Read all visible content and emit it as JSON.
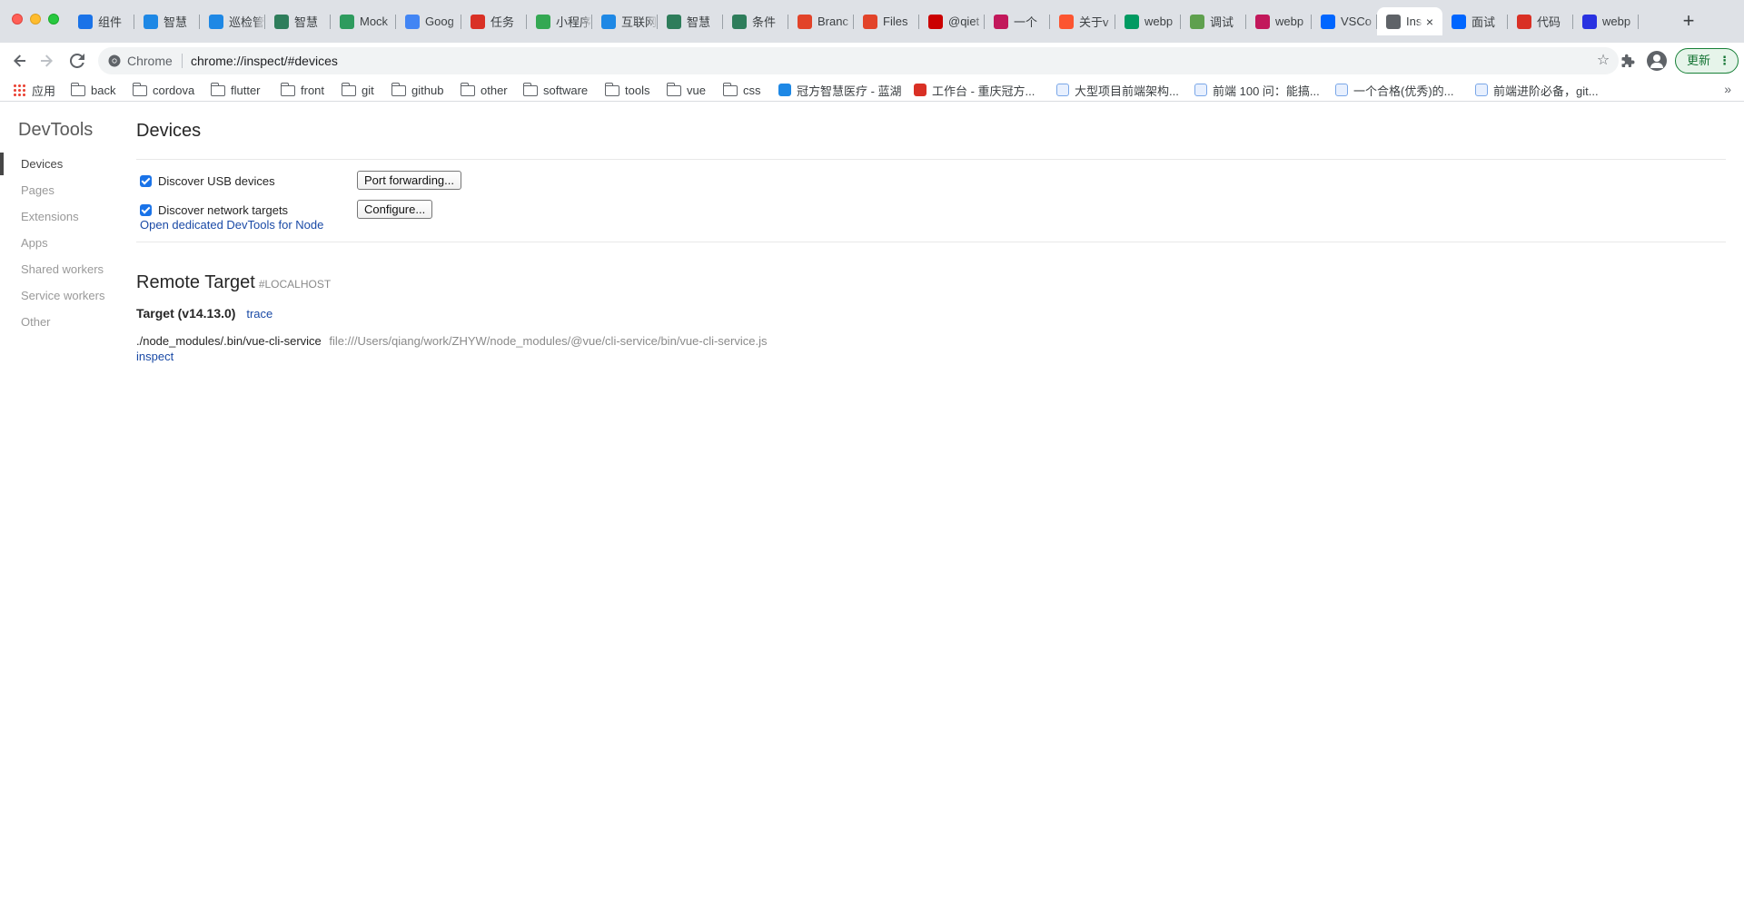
{
  "window": {
    "title": "Inspect with Chrome Developer Tools"
  },
  "tabs": [
    {
      "label": "组件",
      "icon": "blue-circle-icon",
      "color": "#1a73e8",
      "active": false
    },
    {
      "label": "智慧",
      "icon": "bluelake-icon",
      "color": "#1e88e5",
      "active": false
    },
    {
      "label": "巡检管",
      "icon": "bluelake-icon",
      "color": "#1e88e5",
      "active": false
    },
    {
      "label": "智慧",
      "icon": "vue-icon",
      "color": "#2e7d5b",
      "active": false
    },
    {
      "label": "Mock",
      "icon": "mock-icon",
      "color": "#2e9b5e",
      "active": false
    },
    {
      "label": "Goog",
      "icon": "google-translate-icon",
      "color": "#4285f4",
      "active": false
    },
    {
      "label": "任务",
      "icon": "iteye-icon",
      "color": "#d93025",
      "active": false
    },
    {
      "label": "小程序",
      "icon": "leaf-icon",
      "color": "#34a853",
      "active": false
    },
    {
      "label": "互联网",
      "icon": "bluelake-icon",
      "color": "#1e88e5",
      "active": false
    },
    {
      "label": "智慧",
      "icon": "vue-icon",
      "color": "#2e7d5b",
      "active": false
    },
    {
      "label": "条件",
      "icon": "vue-icon",
      "color": "#2e7d5b",
      "active": false
    },
    {
      "label": "Branc",
      "icon": "gitlab-icon",
      "color": "#e24329",
      "active": false
    },
    {
      "label": "Files",
      "icon": "gitlab-icon",
      "color": "#e24329",
      "active": false
    },
    {
      "label": "@qiet",
      "icon": "npm-icon",
      "color": "#cb0000",
      "active": false
    },
    {
      "label": "一个",
      "icon": "juejin-icon",
      "color": "#c2185b",
      "active": false
    },
    {
      "label": "关于v",
      "icon": "csdn-icon",
      "color": "#fc5531",
      "active": false
    },
    {
      "label": "webp",
      "icon": "segmentfault-icon",
      "color": "#009a61",
      "active": false
    },
    {
      "label": "调试",
      "icon": "node-icon",
      "color": "#5fa04e",
      "active": false
    },
    {
      "label": "webp",
      "icon": "juejin-icon",
      "color": "#c2185b",
      "active": false
    },
    {
      "label": "VSCo",
      "icon": "zhihu-icon",
      "color": "#0066ff",
      "active": false
    },
    {
      "label": "Ins",
      "icon": "globe-icon",
      "color": "#5f6368",
      "active": true
    },
    {
      "label": "面试",
      "icon": "zhihu-icon",
      "color": "#0066ff",
      "active": false
    },
    {
      "label": "代码",
      "icon": "iteye-icon",
      "color": "#d93025",
      "active": false
    },
    {
      "label": "webp",
      "icon": "baidu-icon",
      "color": "#2932e1",
      "active": false
    }
  ],
  "toolbar": {
    "back_icon": "arrow-left-icon",
    "forward_icon": "arrow-right-icon",
    "reload_icon": "reload-icon",
    "omnibox_chip": "Chrome",
    "url": "chrome://inspect/#devices",
    "update_label": "更新"
  },
  "bookmarks": [
    {
      "label": "应用",
      "icon": "apps-icon"
    },
    {
      "label": "back",
      "icon": "folder-icon"
    },
    {
      "label": "cordova",
      "icon": "folder-icon"
    },
    {
      "label": "flutter",
      "icon": "folder-icon"
    },
    {
      "label": "front",
      "icon": "folder-icon"
    },
    {
      "label": "git",
      "icon": "folder-icon"
    },
    {
      "label": "github",
      "icon": "folder-icon"
    },
    {
      "label": "other",
      "icon": "folder-icon"
    },
    {
      "label": "software",
      "icon": "folder-icon"
    },
    {
      "label": "tools",
      "icon": "folder-icon"
    },
    {
      "label": "vue",
      "icon": "folder-icon"
    },
    {
      "label": "css",
      "icon": "folder-icon"
    },
    {
      "label": "冠方智慧医疗 - 蓝湖",
      "icon": "bluelake-icon"
    },
    {
      "label": "工作台 - 重庆冠方...",
      "icon": "iteye-icon"
    },
    {
      "label": "大型项目前端架构...",
      "icon": "yuque-icon"
    },
    {
      "label": "前端 100 问：能搞...",
      "icon": "yuque-icon"
    },
    {
      "label": "一个合格(优秀)的...",
      "icon": "yuque-icon"
    },
    {
      "label": "前端进阶必备，git...",
      "icon": "yuque-icon"
    }
  ],
  "devtools": {
    "title": "DevTools",
    "nav": [
      "Devices",
      "Pages",
      "Extensions",
      "Apps",
      "Shared workers",
      "Service workers",
      "Other"
    ],
    "selected_nav": "Devices"
  },
  "devices": {
    "heading": "Devices",
    "discover_usb": {
      "label": "Discover USB devices",
      "checked": true,
      "button": "Port forwarding..."
    },
    "discover_network": {
      "label": "Discover network targets",
      "checked": true,
      "button": "Configure..."
    },
    "node_link": "Open dedicated DevTools for Node"
  },
  "remote": {
    "heading": "Remote Target",
    "sub": "#LOCALHOST",
    "target_name": "Target (v14.13.0)",
    "trace_link": "trace",
    "process_name": "./node_modules/.bin/vue-cli-service",
    "process_url": "file:///Users/qiang/work/ZHYW/node_modules/@vue/cli-service/bin/vue-cli-service.js",
    "inspect_link": "inspect"
  }
}
